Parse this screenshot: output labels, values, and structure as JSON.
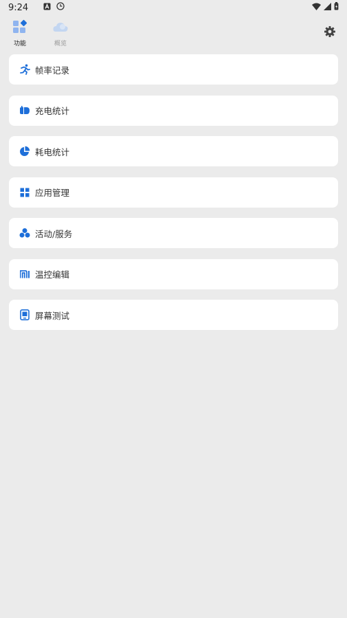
{
  "status_bar": {
    "time": "9:24"
  },
  "tabs": [
    {
      "label": "功能",
      "active": true
    },
    {
      "label": "概览",
      "active": false
    }
  ],
  "menu": [
    {
      "label": "帧率记录",
      "icon": "running-icon"
    },
    {
      "label": "充电统计",
      "icon": "charging-icon"
    },
    {
      "label": "耗电统计",
      "icon": "pie-chart-icon"
    },
    {
      "label": "应用管理",
      "icon": "grid-icon"
    },
    {
      "label": "活动/服务",
      "icon": "activity-icon"
    },
    {
      "label": "温控编辑",
      "icon": "mi-logo-icon"
    },
    {
      "label": "屏幕测试",
      "icon": "screen-icon"
    }
  ],
  "colors": {
    "accent": "#1e6fd9",
    "background": "#ebebeb",
    "card": "#ffffff"
  }
}
